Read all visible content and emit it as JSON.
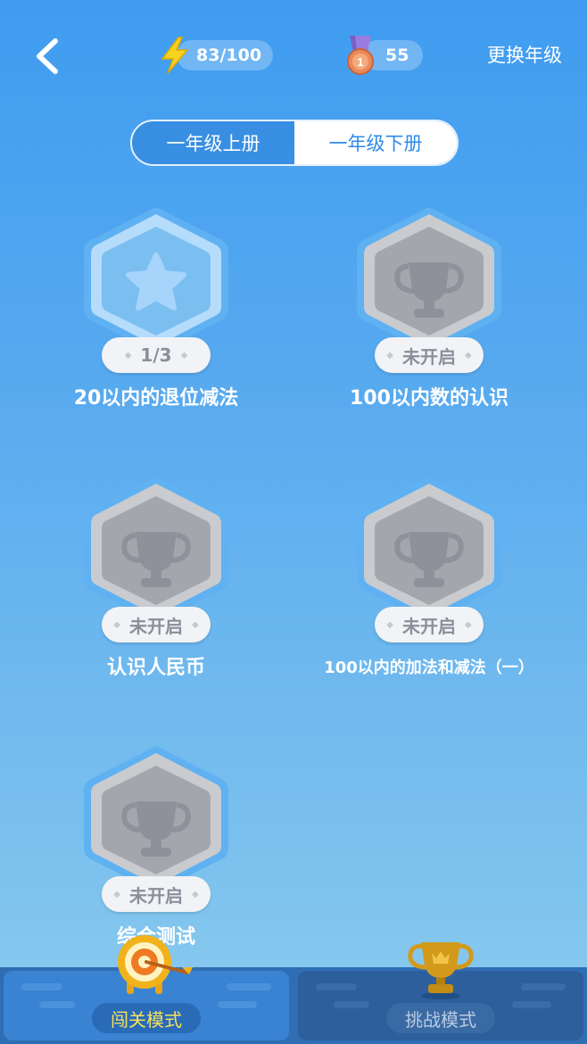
{
  "topbar": {
    "energy": "83/100",
    "medals": "55",
    "medal_number": "1",
    "change_grade": "更换年级"
  },
  "tabs": [
    {
      "label": "一年级上册",
      "active": false
    },
    {
      "label": "一年级下册",
      "active": true
    }
  ],
  "levels": [
    {
      "title": "20以内的退位减法",
      "progress": "1/3",
      "icon": "star-icon",
      "unlocked": true
    },
    {
      "title": "100以内数的认识",
      "progress": "未开启",
      "icon": "trophy-icon",
      "unlocked": false
    },
    {
      "title": "认识人民币",
      "progress": "未开启",
      "icon": "trophy-icon",
      "unlocked": false
    },
    {
      "title": "100以内的加法和减法（一）",
      "progress": "未开启",
      "icon": "trophy-icon",
      "unlocked": false
    },
    {
      "title": "综合测试",
      "progress": "未开启",
      "icon": "trophy-icon",
      "unlocked": false
    }
  ],
  "bottom": {
    "modes": [
      {
        "label": "闯关模式",
        "icon": "target-icon",
        "active": true
      },
      {
        "label": "挑战模式",
        "icon": "trophy-icon",
        "active": false
      }
    ]
  },
  "colors": {
    "accent": "#2f8be6",
    "active_mode_text": "#f7e35a",
    "locked_badge": "#a3a6ad"
  }
}
